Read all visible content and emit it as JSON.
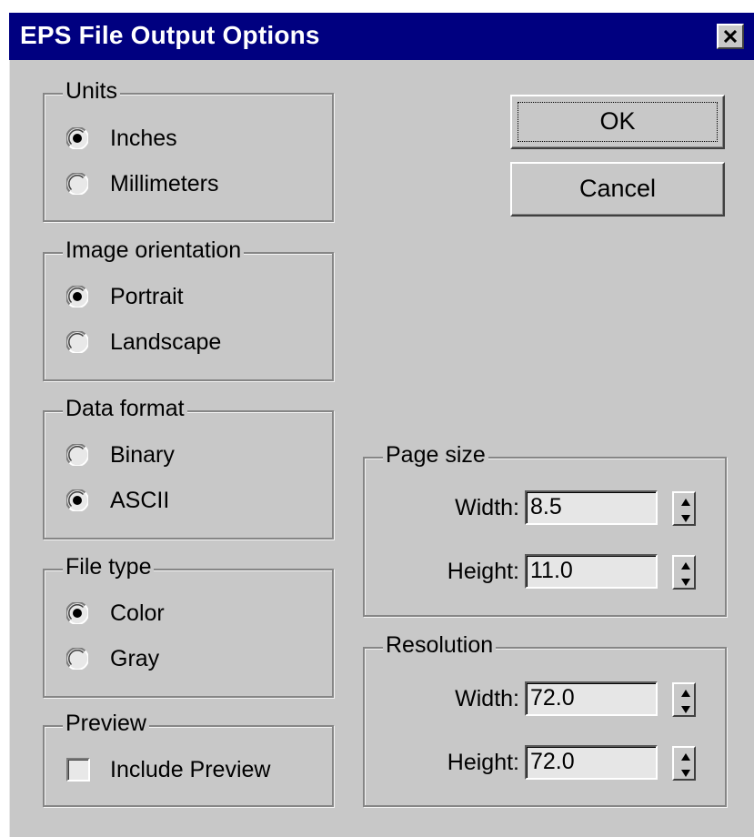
{
  "dialog": {
    "title": "EPS File Output Options",
    "close_icon": "close-x-icon"
  },
  "units": {
    "legend": "Units",
    "options": [
      {
        "label": "Inches",
        "selected": true
      },
      {
        "label": "Millimeters",
        "selected": false
      }
    ]
  },
  "orientation": {
    "legend": "Image orientation",
    "options": [
      {
        "label": "Portrait",
        "selected": true
      },
      {
        "label": "Landscape",
        "selected": false
      }
    ]
  },
  "data_format": {
    "legend": "Data format",
    "options": [
      {
        "label": "Binary",
        "selected": false
      },
      {
        "label": "ASCII",
        "selected": true
      }
    ]
  },
  "file_type": {
    "legend": "File type",
    "options": [
      {
        "label": "Color",
        "selected": true
      },
      {
        "label": "Gray",
        "selected": false
      }
    ]
  },
  "preview": {
    "legend": "Preview",
    "include_label": "Include Preview",
    "include_checked": false
  },
  "buttons": {
    "ok": "OK",
    "cancel": "Cancel"
  },
  "page_size": {
    "legend": "Page size",
    "width_label": "Width:",
    "width_value": "8.5",
    "height_label": "Height:",
    "height_value": "11.0"
  },
  "resolution": {
    "legend": "Resolution",
    "width_label": "Width:",
    "width_value": "72.0",
    "height_label": "Height:",
    "height_value": "72.0"
  },
  "colors": {
    "title_bar": "#000080",
    "dialog_face": "#c8c8c8"
  }
}
